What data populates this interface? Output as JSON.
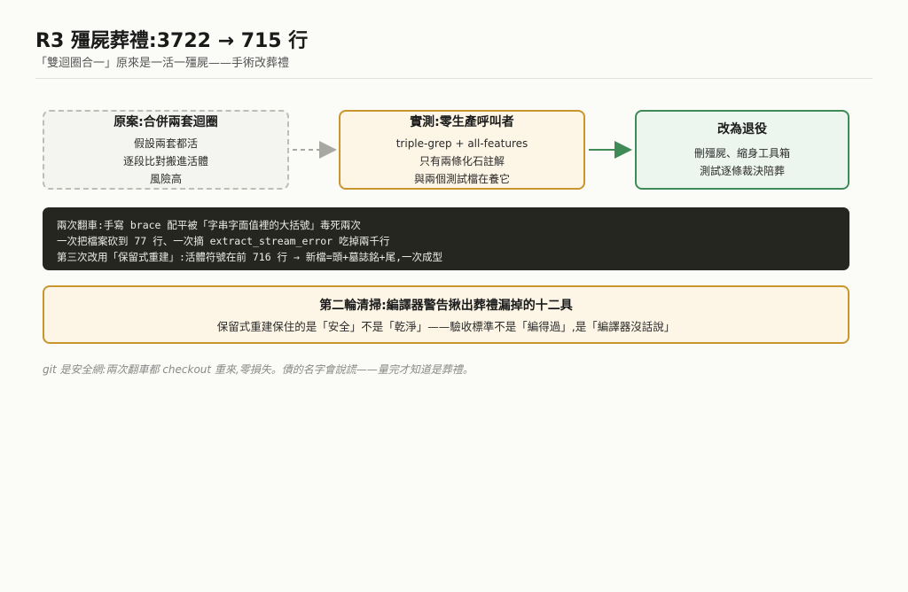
{
  "header": {
    "title": "R3 殭屍葬禮:3722 → 715 行",
    "subtitle": "「雙迴圈合一」原來是一活一殭屍——手術改葬禮"
  },
  "flow": {
    "original": {
      "title": "原案:合併兩套迴圈",
      "lines": [
        "假設兩套都活",
        "逐段比對搬進活體",
        "風險高"
      ]
    },
    "measured": {
      "title": "實測:零生產呼叫者",
      "lines": [
        "triple-grep + all-features",
        "只有兩條化石註解",
        "與兩個測試檔在養它"
      ]
    },
    "changed": {
      "title": "改為退役",
      "lines": [
        "刪殭屍、縮身工具箱",
        "測試逐條裁決陪葬"
      ]
    }
  },
  "terminal": {
    "lines": [
      "兩次翻車:手寫 brace 配平被「字串字面值裡的大括號」毒死兩次",
      "一次把檔案砍到 77 行、一次摘 extract_stream_error 吃掉兩千行",
      "第三次改用「保留式重建」:活體符號在前 716 行 → 新檔=頭+墓誌銘+尾,一次成型"
    ]
  },
  "cleanup": {
    "title": "第二輪清掃:編譯器警告揪出葬禮漏掉的十二具",
    "line": "保留式重建保住的是「安全」不是「乾淨」——驗收標準不是「編得過」,是「編譯器沒話說」"
  },
  "footnote": "git 是安全網:兩次翻車都 checkout 重來,零損失。債的名字會說謊——量完才知道是葬禮。",
  "colors": {
    "dashed_border": "#bdbdb8",
    "amber": "#c9962e",
    "green": "#3f8a57",
    "terminal_bg": "#262621"
  }
}
